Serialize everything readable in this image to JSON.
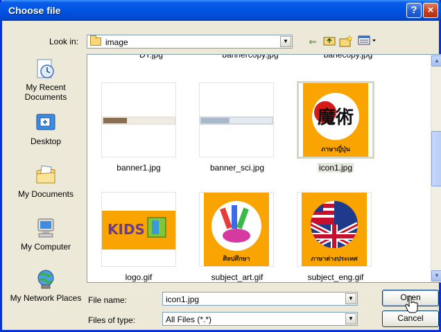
{
  "window": {
    "title": "Choose file"
  },
  "titlebar": {
    "help_label": "?",
    "close_label": "×"
  },
  "lookin": {
    "label": "Look in:",
    "value": "image"
  },
  "places": [
    {
      "label": "My Recent Documents",
      "icon": "recent-documents-icon"
    },
    {
      "label": "Desktop",
      "icon": "desktop-icon"
    },
    {
      "label": "My Documents",
      "icon": "my-documents-icon"
    },
    {
      "label": "My Computer",
      "icon": "my-computer-icon"
    },
    {
      "label": "My Network Places",
      "icon": "network-places-icon"
    }
  ],
  "files": {
    "partial_row": [
      "DT.jpg",
      "bannercopy.jpg",
      "banecopy.jpg"
    ],
    "items": [
      {
        "name": "banner1.jpg",
        "selected": false
      },
      {
        "name": "banner_sci.jpg",
        "selected": false
      },
      {
        "name": "icon1.jpg",
        "selected": true,
        "caption_a": "魔術",
        "caption_b": "ภาษาญี่ปุ่น"
      },
      {
        "name": "logo.gif",
        "selected": false,
        "caption_a": "KIDS"
      },
      {
        "name": "subject_art.gif",
        "selected": false,
        "caption_a": "ศิลปศึกษา"
      },
      {
        "name": "subject_eng.gif",
        "selected": false,
        "caption_a": "ภาษาต่างประเทศ"
      }
    ]
  },
  "filename": {
    "label": "File name:",
    "value": "icon1.jpg"
  },
  "filetype": {
    "label": "Files of type:",
    "value": "All Files (*.*)"
  },
  "buttons": {
    "open": "Open",
    "cancel": "Cancel"
  },
  "colors": {
    "titlebar": "#0055e5",
    "thumb_bg": "#f9a400",
    "selection": "#e6e6dc"
  }
}
